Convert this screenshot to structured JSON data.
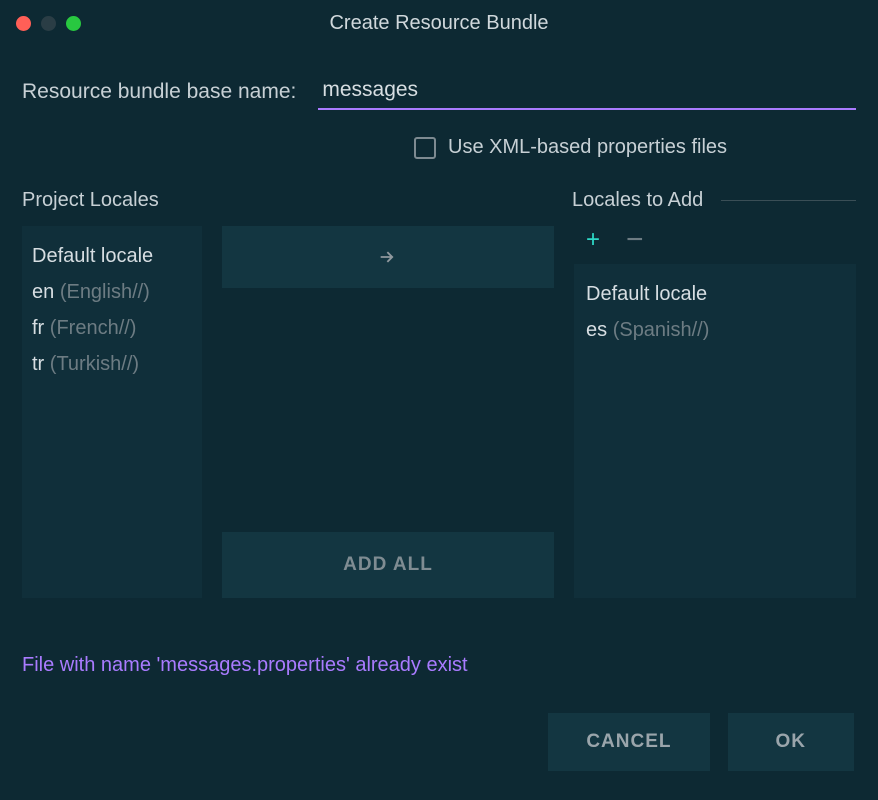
{
  "title": "Create Resource Bundle",
  "labels": {
    "baseName": "Resource bundle base name:",
    "useXml": "Use XML-based properties files",
    "projectLocales": "Project Locales",
    "localesToAdd": "Locales to Add",
    "addAll": "ADD ALL",
    "cancel": "CANCEL",
    "ok": "OK"
  },
  "form": {
    "baseName": "messages",
    "useXmlChecked": false
  },
  "projectLocales": [
    {
      "code": "",
      "label": "Default locale"
    },
    {
      "code": "en",
      "label": "(English//)"
    },
    {
      "code": "fr",
      "label": "(French//)"
    },
    {
      "code": "tr",
      "label": "(Turkish//)"
    }
  ],
  "localesToAdd": [
    {
      "code": "",
      "label": "Default locale"
    },
    {
      "code": "es",
      "label": "(Spanish//)"
    }
  ],
  "error": "File with name 'messages.properties' already exist"
}
